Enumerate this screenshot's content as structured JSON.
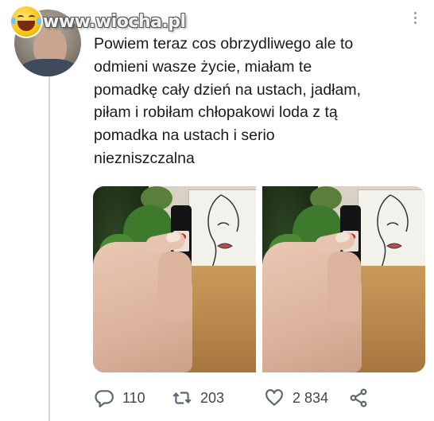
{
  "watermark": {
    "text": "www.wiocha.pl",
    "icon": "laughing-tears-emoji-icon"
  },
  "tweet": {
    "lines": [
      "Powiem teraz cos obrzydliwego ale to",
      "odmieni wasze życie, miałam te",
      "pomadkę cały dzień na ustach, jadłam,",
      "piłam i robiłam chłopakowi loda z tą",
      "pomadka na ustach i serio",
      "niezniszczalna"
    ]
  },
  "media": {
    "photos": [
      {
        "id": 1
      },
      {
        "id": 2
      }
    ]
  },
  "actions": {
    "reply_count": "110",
    "retweet_count": "203",
    "like_count": "2 834"
  },
  "colors": {
    "text": "#1a1a1a",
    "icons": "#5b6770",
    "thread_line": "#cfd9de"
  }
}
